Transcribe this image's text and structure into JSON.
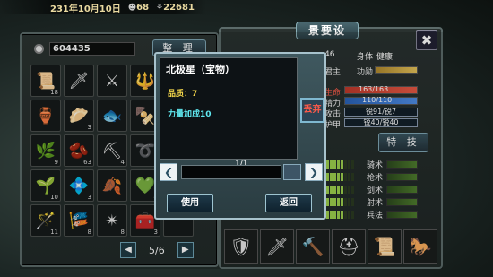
{
  "top_bar": {
    "date": "231年10月10日",
    "population": "68",
    "food": "22681"
  },
  "inventory": {
    "money": "604435",
    "sort_label": "整 理",
    "page": "5/6",
    "prev_icon": "◀",
    "next_icon": "▶",
    "slots": [
      {
        "icon": "scroll-icon",
        "glyph": "📜",
        "count": "18"
      },
      {
        "icon": "spear-icon",
        "glyph": "🗡",
        "count": ""
      },
      {
        "icon": "crossed-swords-icon",
        "glyph": "⚔",
        "count": ""
      },
      {
        "icon": "halberd-icon",
        "glyph": "🔱",
        "count": ""
      },
      {
        "icon": "blank-slot",
        "glyph": "",
        "count": ""
      },
      {
        "icon": "wine-jar-icon",
        "glyph": "🏺",
        "count": ""
      },
      {
        "icon": "dumpling-plate-icon",
        "glyph": "🥟",
        "count": "3"
      },
      {
        "icon": "fish-plate-icon",
        "glyph": "🐟",
        "count": ""
      },
      {
        "icon": "meat-skewer-icon",
        "glyph": "🍢",
        "count": "2"
      },
      {
        "icon": "blank-slot",
        "glyph": "",
        "count": ""
      },
      {
        "icon": "herb-icon",
        "glyph": "🌿",
        "count": "9"
      },
      {
        "icon": "beans-icon",
        "glyph": "🫘",
        "count": "63"
      },
      {
        "icon": "shovel-icon",
        "glyph": "⛏",
        "count": "4"
      },
      {
        "icon": "rope-icon",
        "glyph": "➰",
        "count": ""
      },
      {
        "icon": "blank-slot",
        "glyph": "",
        "count": ""
      },
      {
        "icon": "ginseng-icon",
        "glyph": "🌱",
        "count": "10"
      },
      {
        "icon": "jade-box-icon",
        "glyph": "💠",
        "count": "3"
      },
      {
        "icon": "fire-leaves-icon",
        "glyph": "🍂",
        "count": ""
      },
      {
        "icon": "green-gem-icon",
        "glyph": "💚",
        "count": "4"
      },
      {
        "icon": "blank-slot",
        "glyph": "",
        "count": ""
      },
      {
        "icon": "staff-icon",
        "glyph": "🪄",
        "count": "11"
      },
      {
        "icon": "red-fish-icon",
        "glyph": "🎏",
        "count": "8"
      },
      {
        "icon": "blue-star-icon",
        "glyph": "✴",
        "count": "8"
      },
      {
        "icon": "chest-icon",
        "glyph": "🧰",
        "count": "3"
      },
      {
        "icon": "blank-slot",
        "glyph": "",
        "count": ""
      }
    ]
  },
  "character": {
    "title": "景要设",
    "close_icon": "✖",
    "age_value": "46",
    "body_label": "身体",
    "body_value": "健康",
    "lord_label": "君主",
    "merit_label": "功勋",
    "life_label": "生命",
    "life_value": "163/163",
    "life_fill": 1.0,
    "energy_label": "精力",
    "energy_value": "110/110",
    "energy_fill": 1.0,
    "attack_label": "攻击",
    "attack_value": "锐91/锐7",
    "armor_label": "护甲",
    "armor_value": "锐40/锐40",
    "skill_button": "特 技",
    "skills": [
      {
        "name": "骑术",
        "level": 5
      },
      {
        "name": "枪术",
        "level": 5
      },
      {
        "name": "剑术",
        "level": 5
      },
      {
        "name": "射术",
        "level": 5
      },
      {
        "name": "兵法",
        "level": 5
      }
    ],
    "equipment": [
      {
        "icon": "armor-icon",
        "glyph": "🛡"
      },
      {
        "icon": "sword-icon",
        "glyph": "🗡"
      },
      {
        "icon": "mace-icon",
        "glyph": "🔨"
      },
      {
        "icon": "helmet-icon",
        "glyph": "⛑"
      },
      {
        "icon": "scroll-book-icon",
        "glyph": "📜"
      },
      {
        "icon": "horse-icon",
        "glyph": "🐎"
      }
    ]
  },
  "popup": {
    "item_name": "北极星（宝物）",
    "quality": "品质：7",
    "effect": "力量加成10",
    "discard_label": "丢弃",
    "quantity": "1/1",
    "left_icon": "❮",
    "right_icon": "❯",
    "use_label": "使用",
    "back_label": "返回"
  }
}
